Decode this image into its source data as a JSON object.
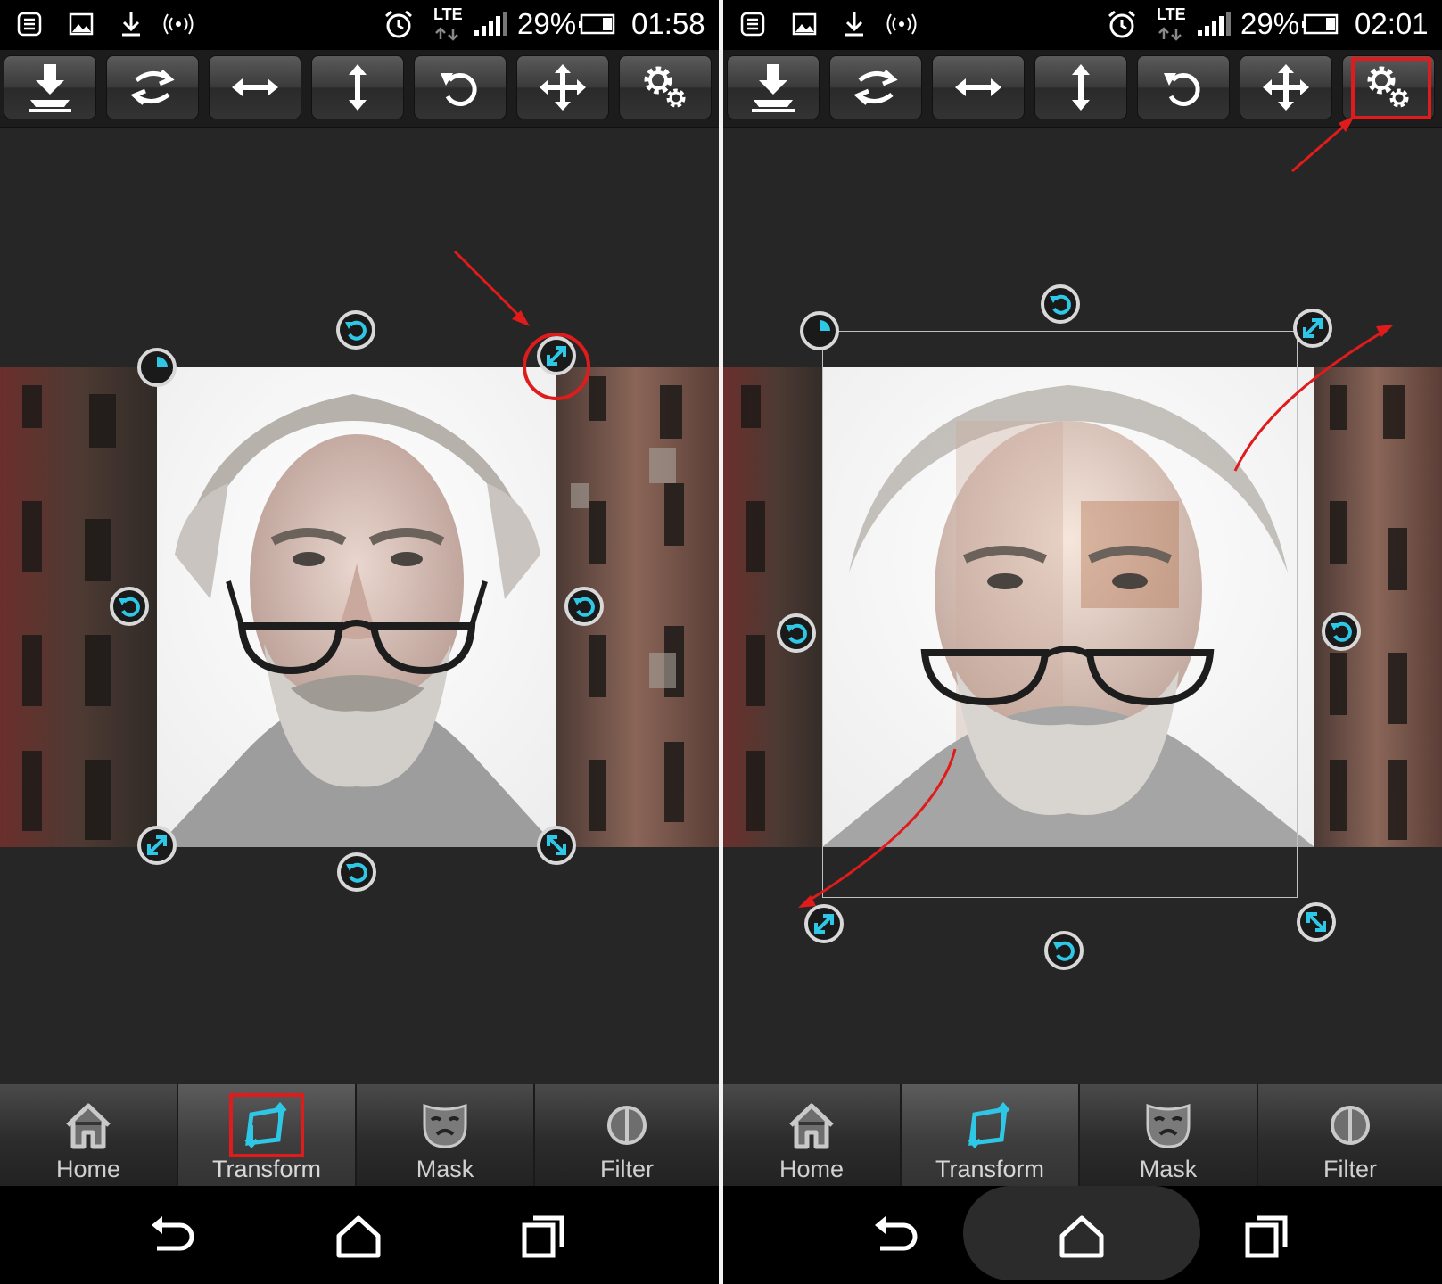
{
  "panels": [
    {
      "status": {
        "battery": "29%",
        "time": "01:58",
        "network": "LTE"
      },
      "tabs": [
        {
          "label": "Home",
          "icon": "home-icon",
          "active": false
        },
        {
          "label": "Transform",
          "icon": "transform-icon",
          "active": true
        },
        {
          "label": "Mask",
          "icon": "mask-icon",
          "active": false
        },
        {
          "label": "Filter",
          "icon": "filter-icon",
          "active": false
        }
      ]
    },
    {
      "status": {
        "battery": "29%",
        "time": "02:01",
        "network": "LTE"
      },
      "tabs": [
        {
          "label": "Home",
          "icon": "home-icon",
          "active": false
        },
        {
          "label": "Transform",
          "icon": "transform-icon",
          "active": true
        },
        {
          "label": "Mask",
          "icon": "mask-icon",
          "active": false
        },
        {
          "label": "Filter",
          "icon": "filter-icon",
          "active": false
        }
      ]
    }
  ],
  "toolbar": [
    "save-icon",
    "swap-icon",
    "flip-horizontal-icon",
    "flip-vertical-icon",
    "rotate-icon",
    "move-icon",
    "settings-icon"
  ],
  "colors": {
    "accent": "#2ec8e6",
    "annotation": "#e01b1b",
    "background": "#262626"
  }
}
